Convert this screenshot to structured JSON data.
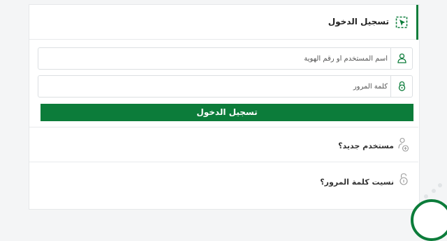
{
  "login": {
    "title": "تسجيل الدخول",
    "username_placeholder": "اسم المستخدم أو رقم الهوية",
    "password_placeholder": "كلمة المرور",
    "submit_label": "تسجيل الدخول"
  },
  "links": {
    "new_user": "مستخدم جديد؟",
    "forgot_password": "نسيت كلمة المرور؟"
  },
  "colors": {
    "accent": "#0c7c3a",
    "border": "#dcdfe2"
  },
  "icons": {
    "header": "login-pointer-icon",
    "username": "user-icon",
    "password": "lock-icon",
    "new_user": "add-user-icon",
    "forgot_password": "unlock-icon"
  }
}
